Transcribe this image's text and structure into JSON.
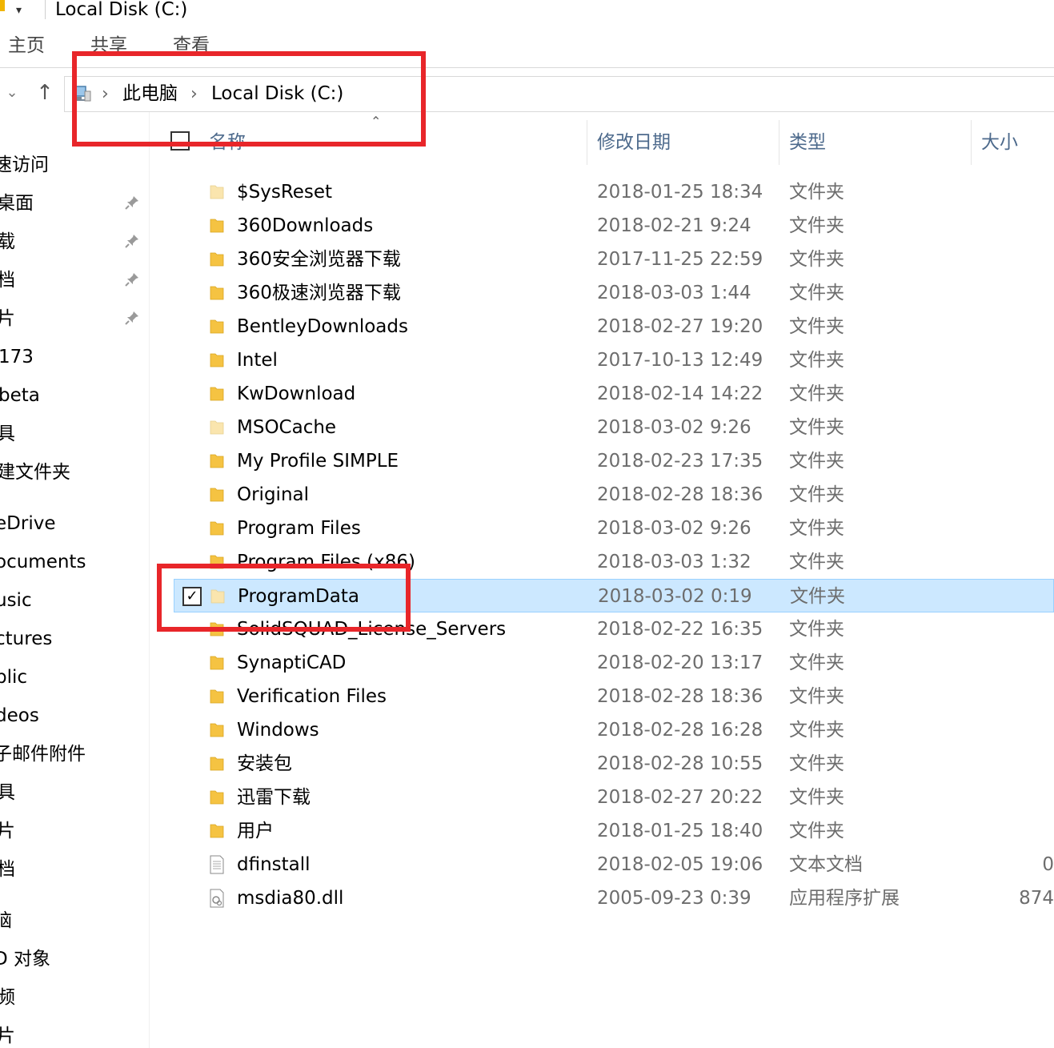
{
  "window": {
    "title": "Local Disk (C:)",
    "qat_dropdown": "▾"
  },
  "ribbon": {
    "tabs": [
      "主页",
      "共享",
      "查看"
    ]
  },
  "address": {
    "breadcrumb": [
      "此电脑",
      "Local Disk (C:)"
    ],
    "separator": "›",
    "nav_down_glyph": "⌄",
    "nav_up_glyph": "↑"
  },
  "columns": {
    "name": "名称",
    "date": "修改日期",
    "type": "类型",
    "size": "大小",
    "sort_indicator": "⌃"
  },
  "sidebar": {
    "pin_glyph": "📌",
    "items": [
      {
        "label": "速访问",
        "pinned": false
      },
      {
        "label": "桌面",
        "pinned": true
      },
      {
        "label": "载",
        "pinned": true
      },
      {
        "label": "档",
        "pinned": true
      },
      {
        "label": "片",
        "pinned": true
      },
      {
        "label": "173",
        "pinned": false
      },
      {
        "label": "beta",
        "pinned": false
      },
      {
        "label": "具",
        "pinned": false
      },
      {
        "label": "建文件夹",
        "pinned": false
      },
      {
        "label": "eDrive",
        "pinned": false
      },
      {
        "label": "ocuments",
        "pinned": false
      },
      {
        "label": "usic",
        "pinned": false
      },
      {
        "label": "ctures",
        "pinned": false
      },
      {
        "label": "blic",
        "pinned": false
      },
      {
        "label": "deos",
        "pinned": false
      },
      {
        "label": "子邮件附件",
        "pinned": false
      },
      {
        "label": "具",
        "pinned": false
      },
      {
        "label": "片",
        "pinned": false
      },
      {
        "label": "档",
        "pinned": false
      },
      {
        "label": "脑",
        "pinned": false
      },
      {
        "label": "D 对象",
        "pinned": false
      },
      {
        "label": "频",
        "pinned": false
      },
      {
        "label": "片",
        "pinned": false
      }
    ]
  },
  "files": [
    {
      "name": "$SysReset",
      "date": "2018-01-25 18:34",
      "type": "文件夹",
      "size": "",
      "icon": "folder-icon",
      "faded": true
    },
    {
      "name": "360Downloads",
      "date": "2018-02-21 9:24",
      "type": "文件夹",
      "size": "",
      "icon": "folder-icon"
    },
    {
      "name": "360安全浏览器下载",
      "date": "2017-11-25 22:59",
      "type": "文件夹",
      "size": "",
      "icon": "folder-icon"
    },
    {
      "name": "360极速浏览器下载",
      "date": "2018-03-03 1:44",
      "type": "文件夹",
      "size": "",
      "icon": "folder-icon"
    },
    {
      "name": "BentleyDownloads",
      "date": "2018-02-27 19:20",
      "type": "文件夹",
      "size": "",
      "icon": "folder-icon"
    },
    {
      "name": "Intel",
      "date": "2017-10-13 12:49",
      "type": "文件夹",
      "size": "",
      "icon": "folder-icon"
    },
    {
      "name": "KwDownload",
      "date": "2018-02-14 14:22",
      "type": "文件夹",
      "size": "",
      "icon": "folder-icon"
    },
    {
      "name": "MSOCache",
      "date": "2018-03-02 9:26",
      "type": "文件夹",
      "size": "",
      "icon": "folder-icon",
      "faded": true
    },
    {
      "name": "My Profile SIMPLE",
      "date": "2018-02-23 17:35",
      "type": "文件夹",
      "size": "",
      "icon": "folder-icon"
    },
    {
      "name": "Original",
      "date": "2018-02-28 18:36",
      "type": "文件夹",
      "size": "",
      "icon": "folder-icon"
    },
    {
      "name": "Program Files",
      "date": "2018-03-02 9:26",
      "type": "文件夹",
      "size": "",
      "icon": "folder-icon"
    },
    {
      "name": "Program Files (x86)",
      "date": "2018-03-03 1:32",
      "type": "文件夹",
      "size": "",
      "icon": "folder-icon"
    },
    {
      "name": "ProgramData",
      "date": "2018-03-02 0:19",
      "type": "文件夹",
      "size": "",
      "icon": "folder-icon",
      "faded": true,
      "selected": true,
      "check": "✓"
    },
    {
      "name": "SolidSQUAD_License_Servers",
      "date": "2018-02-22 16:35",
      "type": "文件夹",
      "size": "",
      "icon": "folder-icon"
    },
    {
      "name": "SynaptiCAD",
      "date": "2018-02-20 13:17",
      "type": "文件夹",
      "size": "",
      "icon": "folder-icon"
    },
    {
      "name": "Verification Files",
      "date": "2018-02-28 18:36",
      "type": "文件夹",
      "size": "",
      "icon": "folder-icon"
    },
    {
      "name": "Windows",
      "date": "2018-02-28 16:28",
      "type": "文件夹",
      "size": "",
      "icon": "folder-icon"
    },
    {
      "name": "安装包",
      "date": "2018-02-28 10:55",
      "type": "文件夹",
      "size": "",
      "icon": "folder-icon"
    },
    {
      "name": "迅雷下载",
      "date": "2018-02-27 20:22",
      "type": "文件夹",
      "size": "",
      "icon": "folder-icon"
    },
    {
      "name": "用户",
      "date": "2018-01-25 18:40",
      "type": "文件夹",
      "size": "",
      "icon": "folder-icon"
    },
    {
      "name": "dfinstall",
      "date": "2018-02-05 19:06",
      "type": "文本文档",
      "size": "0",
      "icon": "text-file-icon"
    },
    {
      "name": "msdia80.dll",
      "date": "2005-09-23 0:39",
      "type": "应用程序扩展",
      "size": "874",
      "icon": "dll-file-icon"
    }
  ],
  "colors": {
    "highlight_border": "#e8262a",
    "selection_bg": "#cce8ff",
    "selection_border": "#99d1ff",
    "folder": "#f5c342",
    "folder_faded": "#fae5ae",
    "header_text": "#4d6a8c",
    "detail_text": "#6d6d6d"
  }
}
